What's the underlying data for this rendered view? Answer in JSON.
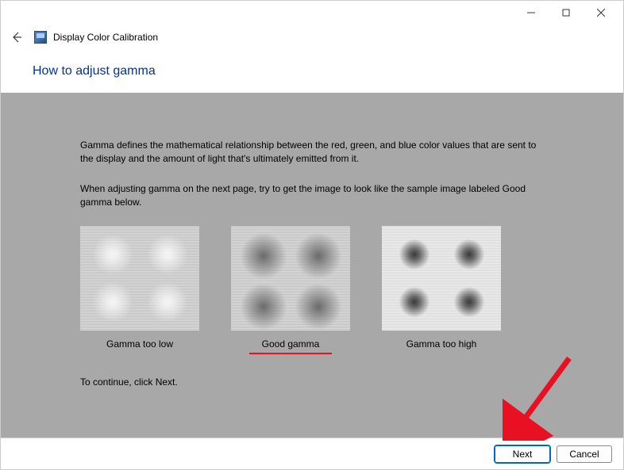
{
  "window": {
    "app_title": "Display Color Calibration"
  },
  "page": {
    "title": "How to adjust gamma"
  },
  "body": {
    "p1": "Gamma defines the mathematical relationship between the red, green, and blue color values that are sent to the display and the amount of light that's ultimately emitted from it.",
    "p2": "When adjusting gamma on the next page, try to get the image to look like the sample image labeled Good gamma below.",
    "continue": "To continue, click Next."
  },
  "samples": {
    "low": "Gamma too low",
    "good": "Good gamma",
    "high": "Gamma too high"
  },
  "footer": {
    "next": "Next",
    "cancel": "Cancel"
  }
}
